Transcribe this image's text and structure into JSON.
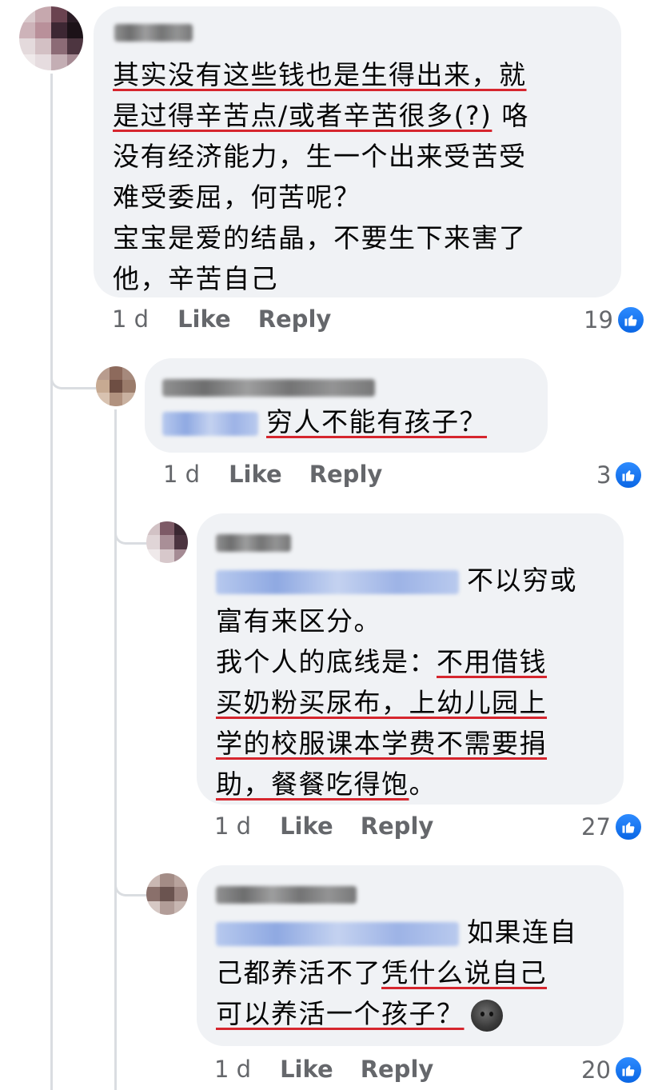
{
  "comments": [
    {
      "text_lines": [
        [
          {
            "t": "其实没有这些钱也是生得出来，就",
            "hl": true
          }
        ],
        [
          {
            "t": "是过得辛苦点/或者辛苦很多(?)",
            "hl": true
          },
          {
            "t": " 咯",
            "hl": false
          }
        ],
        [
          {
            "t": "没有经济能力，生一个出来受苦受",
            "hl": false
          }
        ],
        [
          {
            "t": "难受委屈，何苦呢？",
            "hl": false
          }
        ],
        [
          {
            "t": "宝宝是爱的结晶，不要生下来害了",
            "hl": false
          }
        ],
        [
          {
            "t": "他，辛苦自己",
            "hl": false
          }
        ]
      ],
      "time": "1 d",
      "like": "Like",
      "reply": "Reply",
      "reactions": "19"
    },
    {
      "text_lines": [
        [
          {
            "t": "穷人不能有孩子？",
            "hl": true
          }
        ]
      ],
      "time": "1 d",
      "like": "Like",
      "reply": "Reply",
      "reactions": "3"
    },
    {
      "text_lines": [
        [
          {
            "t": "不以穷或",
            "hl": false
          }
        ],
        [
          {
            "t": "富有来区分。",
            "hl": false
          }
        ],
        [
          {
            "t": "我个人的底线是：",
            "hl": false
          },
          {
            "t": "不用借钱",
            "hl": true
          }
        ],
        [
          {
            "t": "买奶粉买尿布，上幼儿园上",
            "hl": true
          }
        ],
        [
          {
            "t": "学的校服课本学费不需要捐",
            "hl": true
          }
        ],
        [
          {
            "t": "助，餐餐吃得饱",
            "hl": true
          },
          {
            "t": "。",
            "hl": false
          }
        ]
      ],
      "time": "1 d",
      "like": "Like",
      "reply": "Reply",
      "reactions": "27"
    },
    {
      "text_lines": [
        [
          {
            "t": "如果连自",
            "hl": false
          }
        ],
        [
          {
            "t": "己都养活不了",
            "hl": false
          },
          {
            "t": "凭什么说自己",
            "hl": true
          }
        ],
        [
          {
            "t": "可以养活一个孩子？",
            "hl": true
          }
        ]
      ],
      "time": "1 d",
      "like": "Like",
      "reply": "Reply",
      "reactions": "20"
    }
  ],
  "icons": {
    "reaction": "like-icon",
    "emoji": "new-moon-face-emoji"
  },
  "colors": {
    "bubble": "#f0f2f5",
    "underline": "#d6262e",
    "like_blue": "#1877f2",
    "meta_gray": "#65676b"
  }
}
